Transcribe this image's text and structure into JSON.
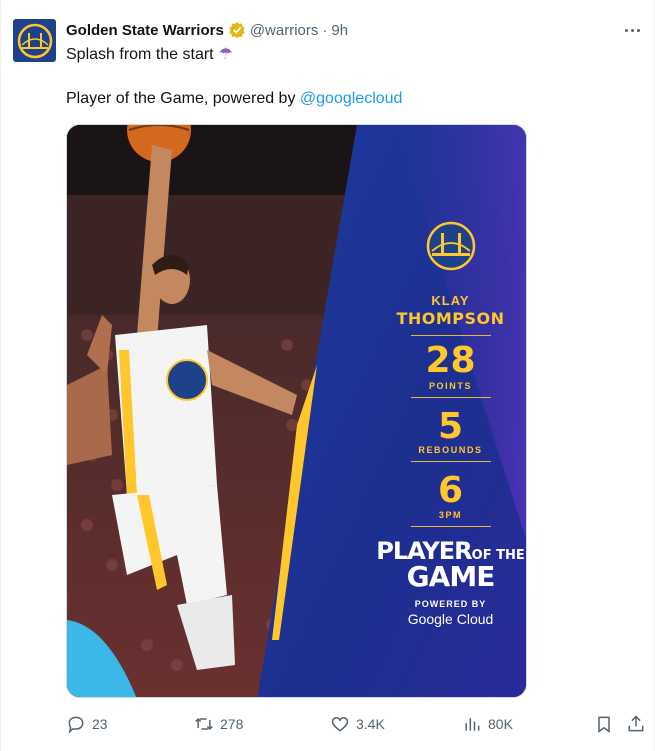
{
  "tweet": {
    "author_name": "Golden State Warriors",
    "handle": "@warriors",
    "separator": "·",
    "time": "9h",
    "line1": "Splash from the start",
    "line2_prefix": "Player of the Game, powered by ",
    "mention": "@googlecloud"
  },
  "graphic": {
    "first_name": "KLAY",
    "last_name": "THOMPSON",
    "stats": [
      {
        "value": "28",
        "label": "POINTS"
      },
      {
        "value": "5",
        "label": "REBOUNDS"
      },
      {
        "value": "6",
        "label": "3PM"
      }
    ],
    "title_a": "PLAYER",
    "title_of": "OF THE",
    "title_b": "GAME",
    "powered_by": "POWERED BY",
    "sponsor": "Google Cloud"
  },
  "actions": {
    "replies": "23",
    "reposts": "278",
    "likes": "3.4K",
    "views": "80K"
  },
  "colors": {
    "brand_blue": "#1d428a",
    "brand_gold": "#ffc72c",
    "link": "#1d9bf0",
    "muted": "#536471"
  }
}
